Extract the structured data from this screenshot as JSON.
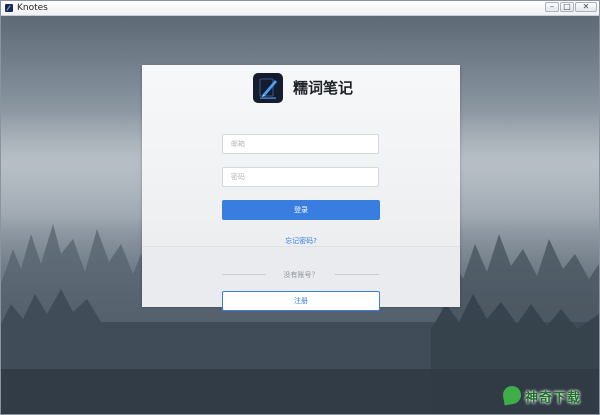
{
  "window": {
    "title": "Knotes",
    "controls": {
      "minimize_glyph": "–",
      "maximize_glyph": "□",
      "close_glyph": "✕"
    }
  },
  "app": {
    "name": "糯词笔记",
    "logo": "pen-notebook-icon"
  },
  "login_form": {
    "email_placeholder": "邮箱",
    "password_placeholder": "密码",
    "login_label": "登录",
    "forgot_password": "忘记密码?",
    "no_account": "没有账号？",
    "register_label": "注册"
  },
  "watermark": {
    "text": "神奇下载"
  },
  "colors": {
    "accent": "#3a7de0",
    "logo_bg": "#141c2e",
    "card_bg": "#f3f4f6"
  }
}
